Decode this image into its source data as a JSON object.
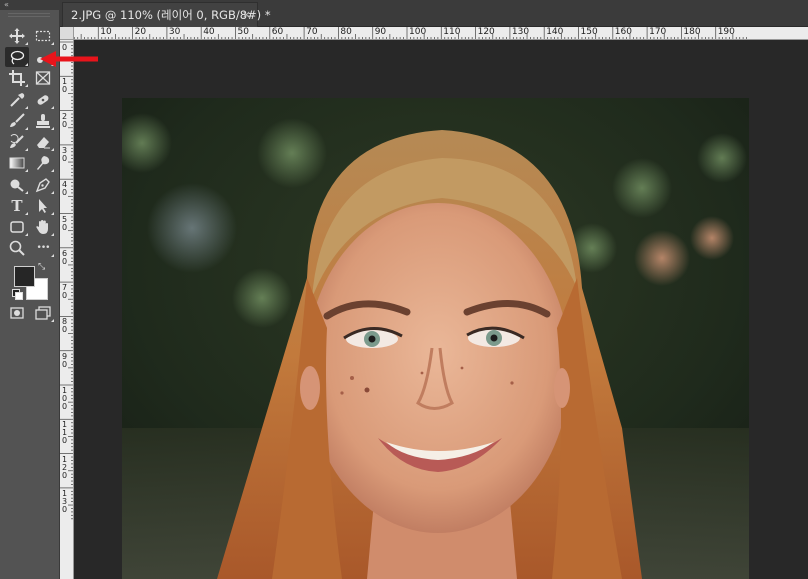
{
  "document_tab": {
    "title": "2.JPG @ 110% (레이어 0, RGB/8#) *",
    "close_glyph": "×"
  },
  "toolbar": {
    "grip_label": "«",
    "tools": [
      {
        "name": "move-tool",
        "icon": "move-icon"
      },
      {
        "name": "marquee-tool",
        "icon": "rectangular-marquee-icon"
      },
      {
        "name": "lasso-tool",
        "icon": "lasso-icon",
        "selected": true
      },
      {
        "name": "quick-selection-tool",
        "icon": "quick-selection-icon"
      },
      {
        "name": "crop-tool",
        "icon": "crop-icon"
      },
      {
        "name": "frame-tool",
        "icon": "frame-icon"
      },
      {
        "name": "eyedropper-tool",
        "icon": "eyedropper-icon"
      },
      {
        "name": "spot-healing-tool",
        "icon": "spot-healing-icon"
      },
      {
        "name": "brush-tool",
        "icon": "brush-icon"
      },
      {
        "name": "clone-stamp-tool",
        "icon": "stamp-icon"
      },
      {
        "name": "history-brush-tool",
        "icon": "history-brush-icon"
      },
      {
        "name": "eraser-tool",
        "icon": "eraser-icon"
      },
      {
        "name": "gradient-tool",
        "icon": "gradient-icon"
      },
      {
        "name": "smudge-tool",
        "icon": "smudge-icon"
      },
      {
        "name": "dodge-tool",
        "icon": "dodge-icon"
      },
      {
        "name": "pen-tool",
        "icon": "pen-icon"
      },
      {
        "name": "type-tool",
        "icon": "type-icon"
      },
      {
        "name": "path-selection-tool",
        "icon": "arrow-icon"
      },
      {
        "name": "rectangle-tool",
        "icon": "rectangle-icon"
      },
      {
        "name": "hand-tool",
        "icon": "hand-icon"
      },
      {
        "name": "zoom-tool",
        "icon": "zoom-icon"
      },
      {
        "name": "more-tools",
        "icon": "ellipsis-icon"
      },
      {
        "name": "quick-mask-button",
        "icon": "quick-mask-icon"
      },
      {
        "name": "screen-mode-button",
        "icon": "screen-mode-icon"
      }
    ],
    "type_glyph": "T",
    "more_glyph": "•••",
    "swap_glyph": "⤡",
    "foreground_color": "#262626",
    "background_color": "#ffffff"
  },
  "rulers": {
    "horizontal_labels": [
      "0",
      "10",
      "20",
      "30",
      "40",
      "50",
      "60",
      "70",
      "80",
      "90",
      "100",
      "110",
      "120",
      "130",
      "140",
      "150",
      "160",
      "170",
      "180",
      "190"
    ],
    "vertical_labels": [
      "0",
      "1 0",
      "2 0",
      "3 0",
      "4 0",
      "5 0",
      "6 0",
      "7 0",
      "8 0",
      "9 0",
      "1 0 0",
      "1 1 0",
      "1 2 0",
      "1 3 0"
    ]
  },
  "annotation": {
    "arrow_color": "#e8141b",
    "points_to": "lasso-tool"
  },
  "accent_colors": {
    "canvas_bg": "#282828",
    "toolbar_bg": "#535353",
    "tab_bg": "#424242",
    "ruler_bg": "#ececec"
  }
}
